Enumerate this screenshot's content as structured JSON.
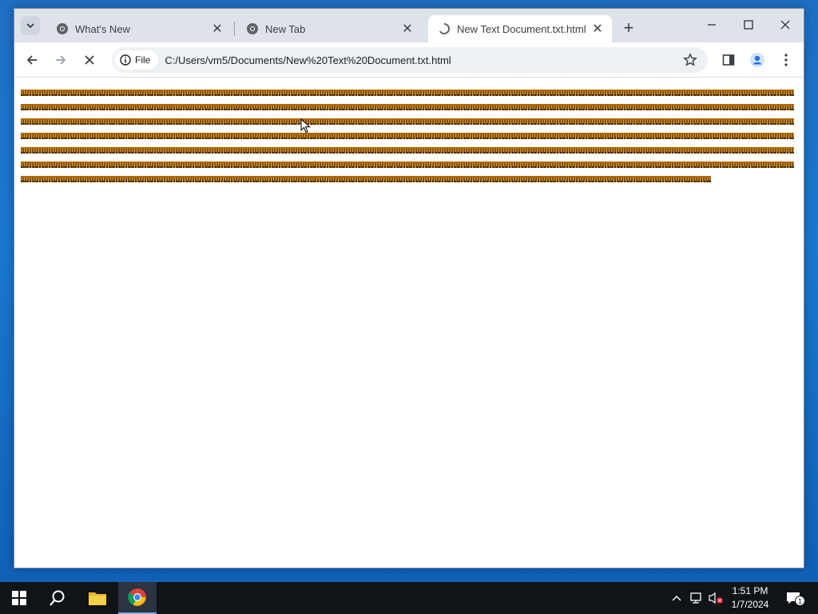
{
  "tabs": [
    {
      "title": "What's New",
      "active": false,
      "icon": "chrome-icon"
    },
    {
      "title": "New Tab",
      "active": false,
      "icon": "chrome-icon"
    },
    {
      "title": "New Text Document.txt.html",
      "active": true,
      "icon": "loading-icon"
    }
  ],
  "toolbar": {
    "scheme_chip": "File",
    "url": "C:/Users/vm5/Documents/New%20Text%20Document.txt.html"
  },
  "page": {
    "lines": [
      {
        "fraction": 1.0
      },
      {
        "fraction": 1.0
      },
      {
        "fraction": 1.0
      },
      {
        "fraction": 1.0
      },
      {
        "fraction": 1.0
      },
      {
        "fraction": 1.0
      },
      {
        "fraction": 0.892
      }
    ]
  },
  "taskbar": {
    "time": "1:51 PM",
    "date": "1/7/2024",
    "notification_count": "1"
  },
  "colors": {
    "tabstrip": "#dee3ea",
    "text_line": "#b06a00",
    "taskbar": "#101418"
  }
}
